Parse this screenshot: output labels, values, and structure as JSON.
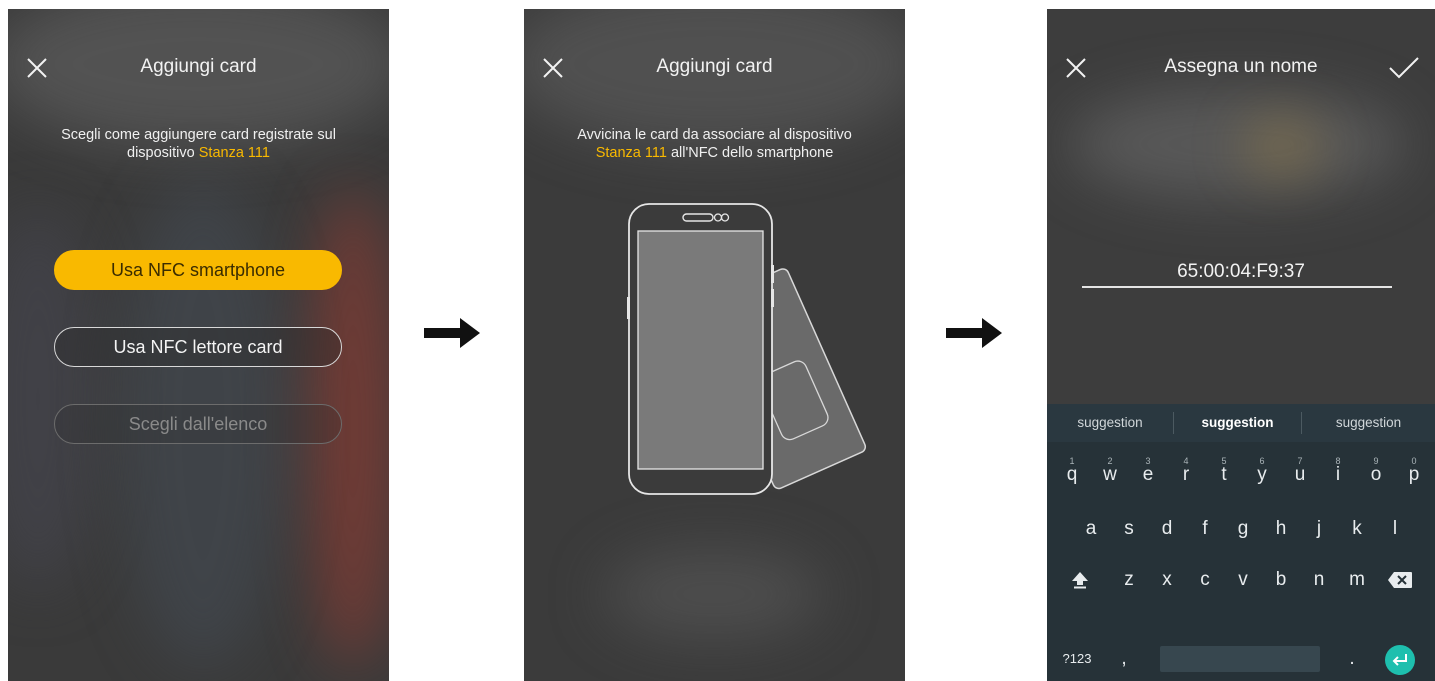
{
  "screen1": {
    "title": "Aggiungi card",
    "description_line1": "Scegli come aggiungere card registrate sul",
    "description_line2_prefix": "dispositivo ",
    "device_name": "Stanza 111",
    "buttons": {
      "nfc_smartphone": "Usa NFC smartphone",
      "nfc_reader": "Usa NFC lettore card",
      "choose_list": "Scegli dall'elenco"
    }
  },
  "screen2": {
    "title": "Aggiungi card",
    "description_line1": "Avvicina le card da associare al dispositivo",
    "device_name": "Stanza 111",
    "description_line2_suffix": " all'NFC dello smartphone",
    "illustration_icon": "phone-nfc-card-icon"
  },
  "screen3": {
    "title": "Assegna un nome",
    "name_value": "65:00:04:F9:37",
    "suggestions": [
      "suggestion",
      "suggestion",
      "suggestion"
    ],
    "keyboard": {
      "row1": [
        "q",
        "w",
        "e",
        "r",
        "t",
        "y",
        "u",
        "i",
        "o",
        "p"
      ],
      "row1_hints": [
        "1",
        "2",
        "3",
        "4",
        "5",
        "6",
        "7",
        "8",
        "9",
        "0"
      ],
      "row2": [
        "a",
        "s",
        "d",
        "f",
        "g",
        "h",
        "j",
        "k",
        "l"
      ],
      "row3": [
        "z",
        "x",
        "c",
        "v",
        "b",
        "n",
        "m"
      ],
      "symbols_key": "?123",
      "comma_key": ",",
      "period_key": "."
    }
  },
  "colors": {
    "accent": "#f9b900",
    "background": "#3a3a3a",
    "keyboard": "#263238",
    "enter_key": "#1ebfae"
  }
}
